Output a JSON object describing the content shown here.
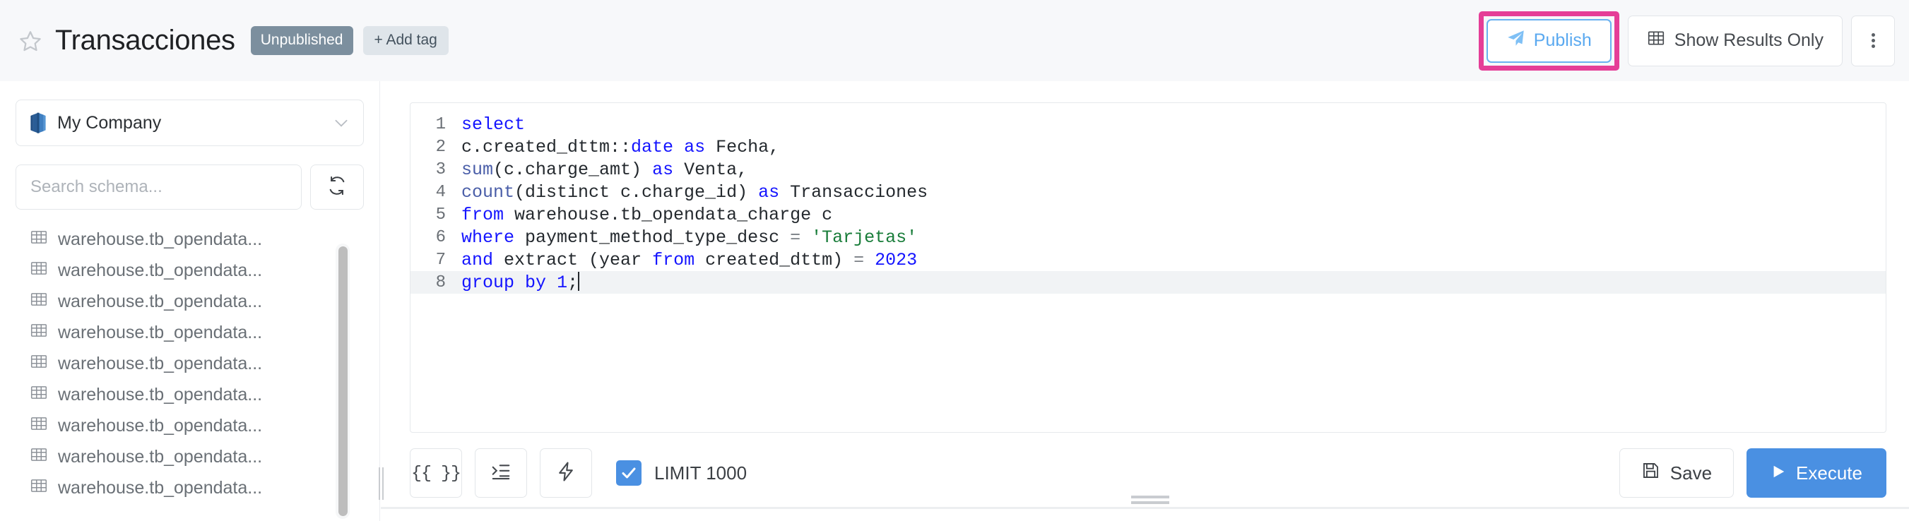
{
  "header": {
    "star_icon": "star-outline-icon",
    "title": "Transacciones",
    "badge_unpublished": "Unpublished",
    "add_tag_label": "+ Add tag",
    "publish_label": "Publish",
    "publish_icon": "paper-plane-icon",
    "show_results_label": "Show Results Only",
    "show_results_icon": "table-grid-icon",
    "kebab_icon": "more-vertical-icon",
    "highlight_color": "#e53e97",
    "publish_accent": "#5aa9f0"
  },
  "sidebar": {
    "database": {
      "label": "My Company",
      "icon": "redshift-database-icon",
      "chevron": "chevron-down-icon"
    },
    "search": {
      "placeholder": "Search schema...",
      "value": ""
    },
    "refresh_icon": "refresh-icon",
    "tables": [
      {
        "name": "warehouse.tb_opendata...",
        "icon": "table-icon"
      },
      {
        "name": "warehouse.tb_opendata...",
        "icon": "table-icon"
      },
      {
        "name": "warehouse.tb_opendata...",
        "icon": "table-icon"
      },
      {
        "name": "warehouse.tb_opendata...",
        "icon": "table-icon"
      },
      {
        "name": "warehouse.tb_opendata...",
        "icon": "table-icon"
      },
      {
        "name": "warehouse.tb_opendata...",
        "icon": "table-icon"
      },
      {
        "name": "warehouse.tb_opendata...",
        "icon": "table-icon"
      },
      {
        "name": "warehouse.tb_opendata...",
        "icon": "table-icon"
      },
      {
        "name": "warehouse.tb_opendata...",
        "icon": "table-icon"
      }
    ]
  },
  "editor": {
    "lines": [
      {
        "n": "1",
        "active": false
      },
      {
        "n": "2",
        "active": false
      },
      {
        "n": "3",
        "active": false
      },
      {
        "n": "4",
        "active": false
      },
      {
        "n": "5",
        "active": false
      },
      {
        "n": "6",
        "active": false
      },
      {
        "n": "7",
        "active": false
      },
      {
        "n": "8",
        "active": true
      }
    ],
    "sql_text": "select\nc.created_dttm::date as Fecha,\nsum(c.charge_amt) as Venta,\ncount(distinct c.charge_id) as Transacciones\nfrom warehouse.tb_opendata_charge c\nwhere payment_method_type_desc = 'Tarjetas'\nand extract (year from created_dttm) = 2023\ngroup by 1;",
    "line1": {
      "kw": "select"
    },
    "line2": {
      "a": "c.created_dttm::",
      "kw1": "date",
      "b": " ",
      "kw2": "as",
      "c": " Fecha,"
    },
    "line3": {
      "fn": "sum",
      "a": "(c.charge_amt) ",
      "kw": "as",
      "b": " Venta,"
    },
    "line4": {
      "fn": "count",
      "a": "(distinct c.charge_id) ",
      "kw": "as",
      "b": " Transacciones"
    },
    "line5": {
      "kw": "from",
      "a": " warehouse.tb_opendata_charge c"
    },
    "line6": {
      "kw": "where",
      "a": " payment_method_type_desc ",
      "op": "=",
      "b": " ",
      "str": "'Tarjetas'"
    },
    "line7": {
      "kw1": "and",
      "a": " extract (year ",
      "kw2": "from",
      "b": " created_dttm) ",
      "op": "=",
      "c": " ",
      "num": "2023"
    },
    "line8": {
      "kw1": "group",
      "a": " ",
      "kw2": "by",
      "b": " ",
      "num": "1",
      "c": ";"
    }
  },
  "toolbar": {
    "variables_label": "{{ }}",
    "format_icon": "indent-format-icon",
    "lightning_icon": "lightning-bolt-icon",
    "limit_label": "LIMIT 1000",
    "limit_checked": true,
    "save_label": "Save",
    "save_icon": "floppy-disk-icon",
    "execute_label": "Execute",
    "execute_icon": "play-triangle-icon",
    "execute_color": "#4a90e2"
  }
}
